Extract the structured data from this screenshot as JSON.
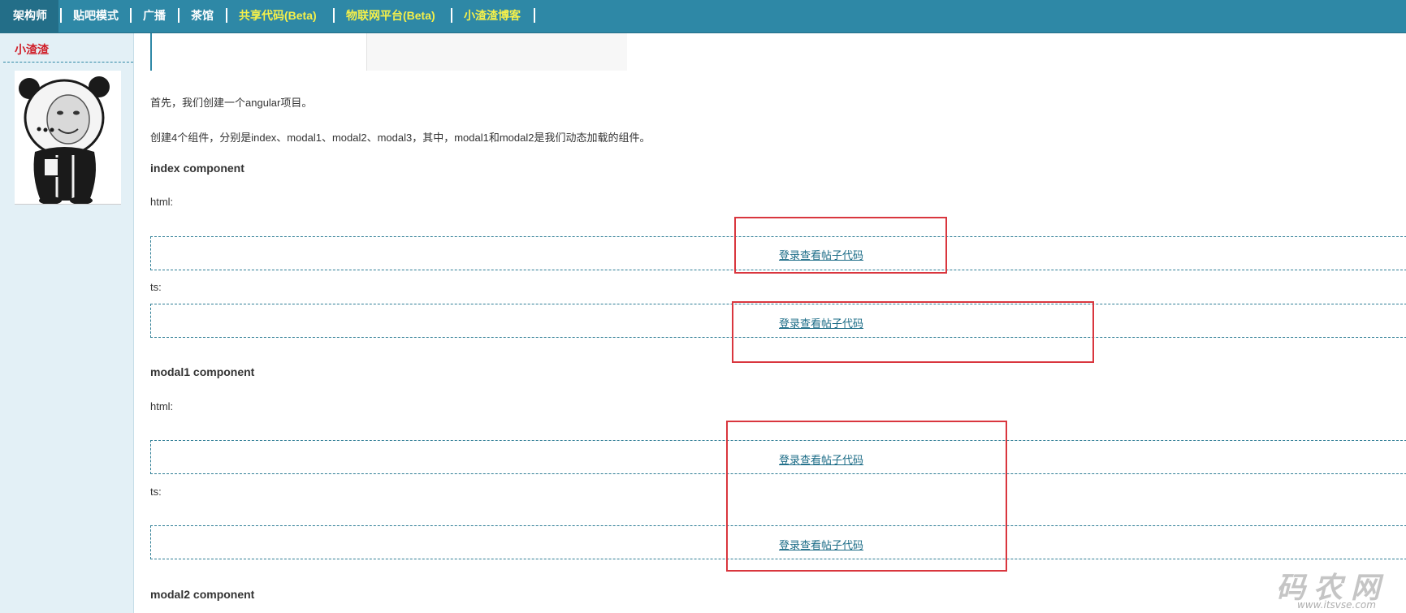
{
  "nav": {
    "items": [
      {
        "label": "架构师",
        "active": true
      },
      {
        "label": "贴吧模式"
      },
      {
        "label": "广播"
      },
      {
        "label": "茶馆"
      },
      {
        "label": "共享代码(Beta)",
        "highlight": true
      },
      {
        "label": "物联网平台(Beta)",
        "highlight": true
      },
      {
        "label": "小渣渣博客",
        "highlight": true
      }
    ]
  },
  "sidebar": {
    "username": "小渣渣",
    "avatar_icon": "panda-meme-avatar"
  },
  "content": {
    "p1": "首先，我们创建一个angular项目。",
    "p2": "创建4个组件，分别是index、modal1、modal2、modal3，其中，modal1和modal2是我们动态加载的组件。",
    "h_index": "index component",
    "index_html_label": "html:",
    "index_html_link": "登录查看帖子代码",
    "index_ts_label": "ts:",
    "index_ts_link": "登录查看帖子代码",
    "h_modal1": "modal1 component",
    "modal1_html_label": "html:",
    "modal1_html_link": "登录查看帖子代码",
    "modal1_ts_label": "ts:",
    "modal1_ts_link": "登录查看帖子代码",
    "h_modal2": "modal2 component"
  },
  "watermark": {
    "main": "码农网",
    "url": "www.itsvse.com"
  },
  "colors": {
    "nav_bg": "#2e88a6",
    "highlight": "#f5f04a",
    "username": "#d0202a",
    "annotation_red": "#d9363e"
  }
}
